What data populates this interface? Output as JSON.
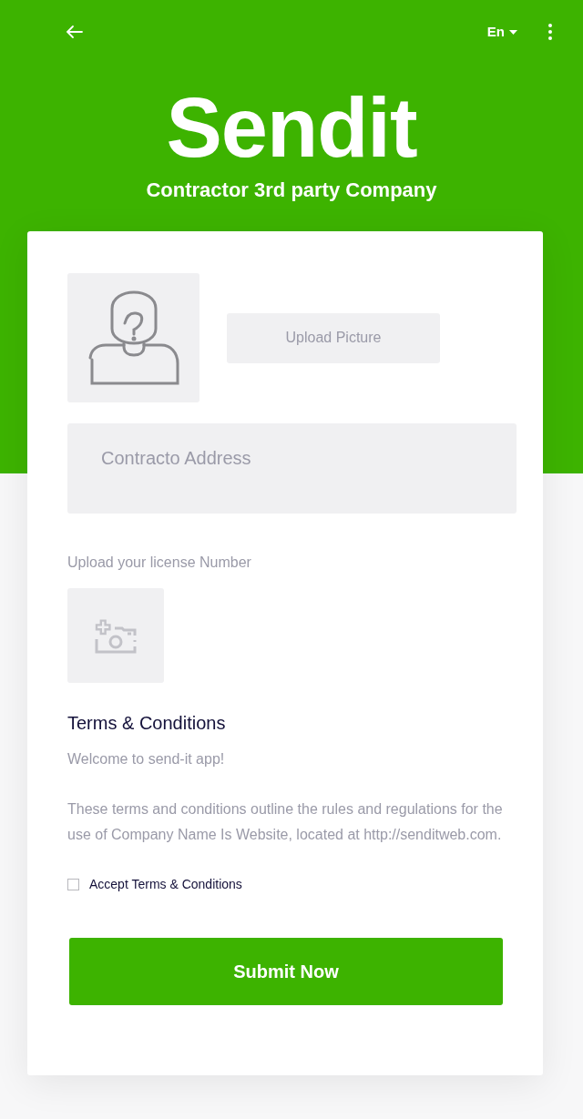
{
  "top_bar": {
    "language": "En"
  },
  "brand": {
    "title": "Sendit",
    "subtitle": "Contractor 3rd party Company"
  },
  "form": {
    "upload_button": "Upload Picture",
    "address": {
      "placeholder": "Contracto Address"
    },
    "license_label": "Upload your license Number",
    "terms_title": "Terms & Conditions",
    "terms_paragraphs": [
      "Welcome to send-it app!",
      "These terms and conditions outline the rules and regulations for the use of Company Name Is Website, located at http://senditweb.com."
    ],
    "accept": {
      "label": "Accept Terms & Conditions",
      "checked": false
    },
    "submit": "Submit Now"
  }
}
